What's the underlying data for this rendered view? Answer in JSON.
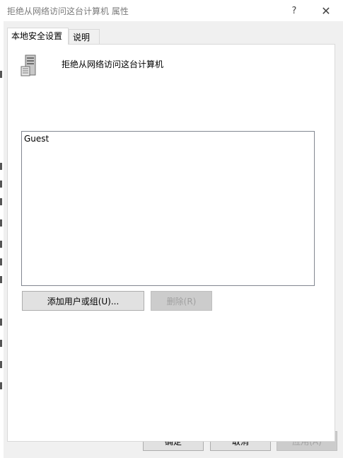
{
  "window": {
    "title": "拒绝从网络访问这台计算机 属性",
    "help_glyph": "?",
    "close_glyph": "✕"
  },
  "tabs": [
    {
      "label": "本地安全设置",
      "active": true
    },
    {
      "label": "说明",
      "active": false
    }
  ],
  "policy": {
    "icon": "server-icon",
    "name": "拒绝从网络访问这台计算机"
  },
  "members": [
    "Guest"
  ],
  "buttons": {
    "add": "添加用户或组(U)...",
    "remove": "删除(R)",
    "ok": "确定",
    "cancel": "取消",
    "apply": "应用(A)"
  }
}
